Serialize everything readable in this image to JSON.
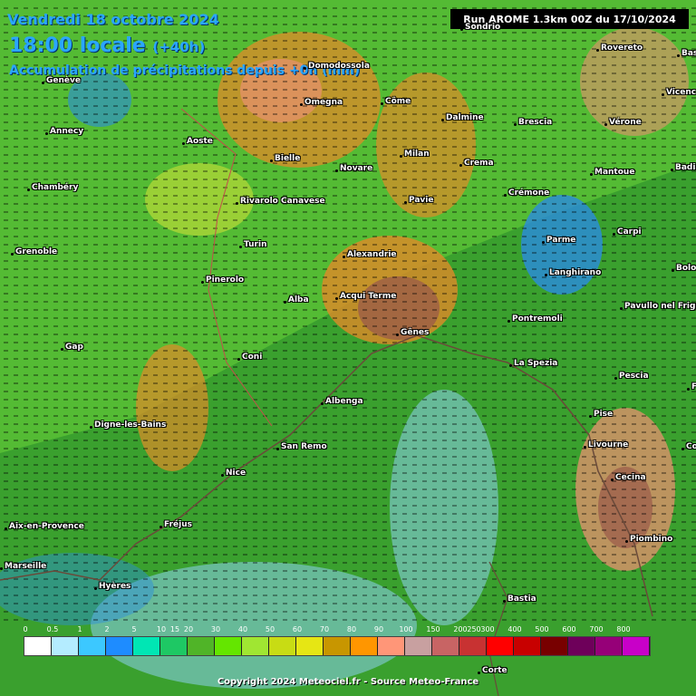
{
  "header": {
    "date": "Vendredi 18 octobre 2024",
    "time": "18:00 locale",
    "lead": "(+40h)",
    "accumulation": "Accumulation de précipitations depuis +0h (mm)"
  },
  "run_info": "Run AROME 1.3km 00Z du 17/10/2024",
  "copyright": "Copyright 2024 Meteociel.fr - Source Meteo-France",
  "cities": [
    {
      "name": "Sondrio"
    },
    {
      "name": "Rovereto"
    },
    {
      "name": "Bass"
    },
    {
      "name": "Genève"
    },
    {
      "name": "Domodossola"
    },
    {
      "name": "Omegna"
    },
    {
      "name": "Côme"
    },
    {
      "name": "Dalmine"
    },
    {
      "name": "Brescia"
    },
    {
      "name": "Vérone"
    },
    {
      "name": "Vicence"
    },
    {
      "name": "Annecy"
    },
    {
      "name": "Aoste"
    },
    {
      "name": "Bielle"
    },
    {
      "name": "Novare"
    },
    {
      "name": "Milan"
    },
    {
      "name": "Crema"
    },
    {
      "name": "Mantoue"
    },
    {
      "name": "Badia"
    },
    {
      "name": "Chambéry"
    },
    {
      "name": "Rivarolo Canavese"
    },
    {
      "name": "Pavie"
    },
    {
      "name": "Crémone"
    },
    {
      "name": "Parme"
    },
    {
      "name": "Carpi"
    },
    {
      "name": "Grenoble"
    },
    {
      "name": "Turin"
    },
    {
      "name": "Alexandrie"
    },
    {
      "name": "Langhirano"
    },
    {
      "name": "Bolo"
    },
    {
      "name": "Pinerolo"
    },
    {
      "name": "Alba"
    },
    {
      "name": "Acqui Terme"
    },
    {
      "name": "Pavullo nel Frigna"
    },
    {
      "name": "Gap"
    },
    {
      "name": "Gênes"
    },
    {
      "name": "Pontremoli"
    },
    {
      "name": "Coni"
    },
    {
      "name": "La Spezia"
    },
    {
      "name": "Pescia"
    },
    {
      "name": "Fl"
    },
    {
      "name": "Albenga"
    },
    {
      "name": "Pise"
    },
    {
      "name": "Digne-les-Bains"
    },
    {
      "name": "San Remo"
    },
    {
      "name": "Livourne"
    },
    {
      "name": "Co"
    },
    {
      "name": "Nice"
    },
    {
      "name": "Cecina"
    },
    {
      "name": "Aix-en-Provence"
    },
    {
      "name": "Fréjus"
    },
    {
      "name": "Piombino"
    },
    {
      "name": "Marseille"
    },
    {
      "name": "Hyères"
    },
    {
      "name": "Bastia"
    },
    {
      "name": "Corte"
    }
  ],
  "legend": {
    "labels": [
      "0",
      "0.5",
      "1",
      "2",
      "5",
      "10",
      "15",
      "20",
      "30",
      "40",
      "50",
      "60",
      "70",
      "80",
      "90",
      "100",
      "150",
      "200",
      "250",
      "300",
      "400",
      "500",
      "600",
      "700",
      "800"
    ],
    "colors": [
      "#ffffff",
      "#b4ecff",
      "#3cc8ff",
      "#1e8cff",
      "#00e6b4",
      "#1ec864",
      "#50b428",
      "#64e600",
      "#a0e632",
      "#c8dc14",
      "#e6e614",
      "#c89600",
      "#ff9600",
      "#ff9678",
      "#c8a0a0",
      "#c86464",
      "#c83232",
      "#ff0000",
      "#c80000",
      "#780000",
      "#6e005a",
      "#960078",
      "#c800c8"
    ]
  },
  "map_colors": {
    "base_green": "#3aa02e",
    "bright_green": "#6ad23a",
    "yellow_green": "#b8d838",
    "orange": "#e08a28",
    "salmon": "#e89070",
    "brown": "#9a5a4a",
    "light_blue": "#8ccff0",
    "mid_blue": "#2a8be0",
    "border": "#c0504a"
  }
}
